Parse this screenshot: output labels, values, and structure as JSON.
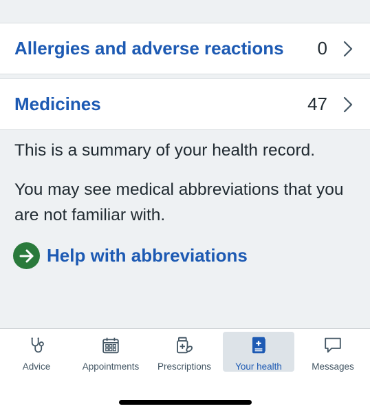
{
  "records": [
    {
      "label": "Allergies and adverse reactions",
      "count": "0"
    },
    {
      "label": "Medicines",
      "count": "47"
    }
  ],
  "summary_text": "This is a summary of your health record.",
  "abbrev_text": "You may see medical abbreviations that you are not familiar with.",
  "help_link": "Help with abbreviations",
  "tabs": [
    {
      "label": "Advice",
      "icon": "stethoscope-icon"
    },
    {
      "label": "Appointments",
      "icon": "calendar-icon"
    },
    {
      "label": "Prescriptions",
      "icon": "pill-bottle-icon"
    },
    {
      "label": "Your health",
      "icon": "health-record-icon",
      "active": true
    },
    {
      "label": "Messages",
      "icon": "speech-bubble-icon"
    }
  ],
  "colors": {
    "link": "#1d5ab3",
    "help_icon": "#2a7a3b",
    "background": "#eef1f3"
  }
}
